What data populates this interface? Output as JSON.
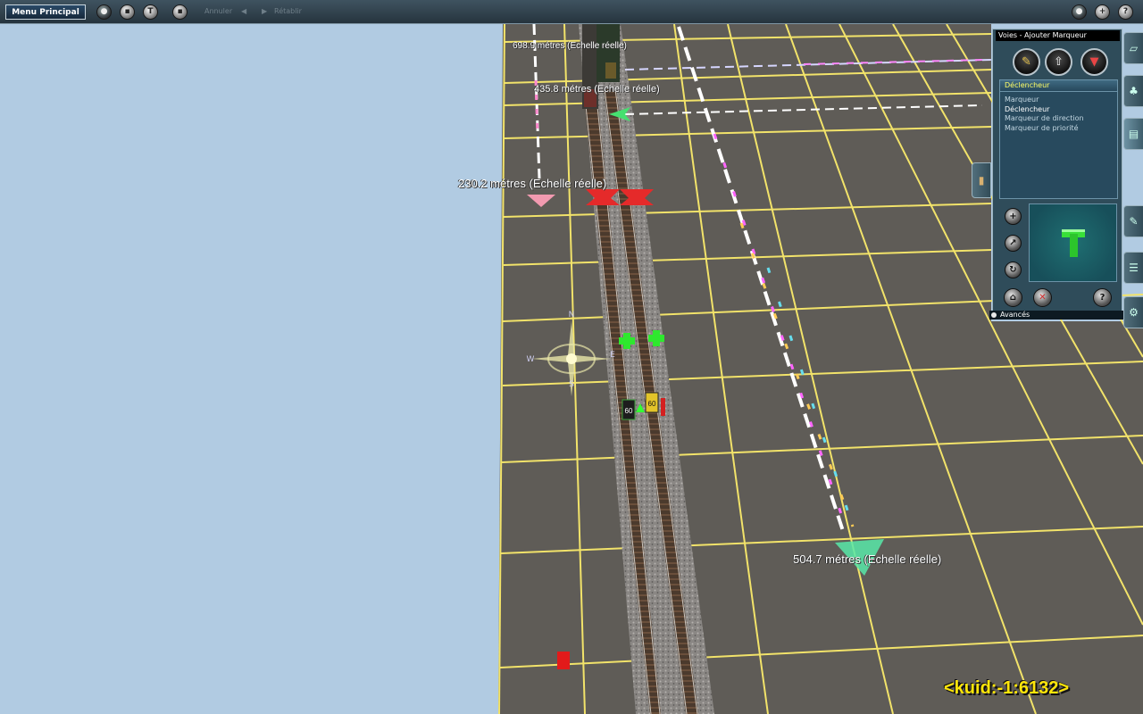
{
  "toolbar": {
    "menu_label": "Menu Principal",
    "undo_label": "Annuler",
    "redo_label": "Rétablir"
  },
  "measurements": [
    {
      "text": "698.9 métres  (Echelle réelle)"
    },
    {
      "text": "435.8 métres  (Echelle réelle)"
    },
    {
      "text": "230.2 métres  (Echelle réelle)"
    },
    {
      "text": "504.7 métres  (Echelle réelle)"
    }
  ],
  "signs": {
    "speed_1": "60",
    "speed_2": "60"
  },
  "compass": {
    "north": "N",
    "south": "S",
    "east": "E",
    "west": "W"
  },
  "kuid": "<kuid:-1:6132>",
  "panel": {
    "title": "Voies - Ajouter Marqueur",
    "selected": "Déclencheur",
    "list": [
      {
        "label": "Marqueur",
        "active": false
      },
      {
        "label": "Déclencheur",
        "active": true
      },
      {
        "label": "Marqueur de direction",
        "active": false
      },
      {
        "label": "Marqueur de priorité",
        "active": false
      }
    ],
    "advanced_label": "Avancés"
  },
  "colors": {
    "sky": "#b1cbe2",
    "grid_line": "#f2e36a",
    "ground": "#5f5c57",
    "panel_bg": "#2f4c5a",
    "kuid_text": "#ffe60a",
    "selected_text": "#ffff66"
  }
}
